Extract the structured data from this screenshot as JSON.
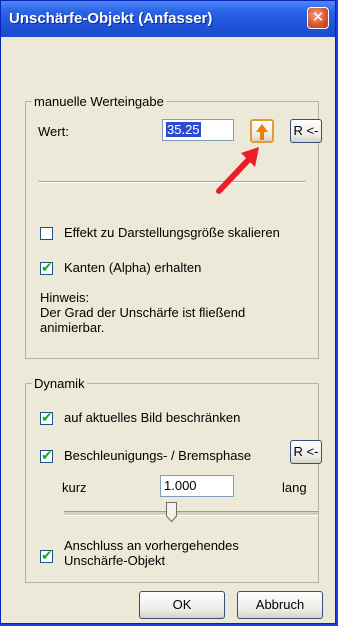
{
  "window": {
    "title": "Unschärfe-Objekt (Anfasser)"
  },
  "manual_group": {
    "legend": "manuelle Werteingabe",
    "value_label": "Wert:",
    "value": "35.25",
    "reset_label": "R <-",
    "checkbox_scale": {
      "label": "Effekt zu Darstellungsgröße skalieren",
      "checked": false
    },
    "checkbox_alpha": {
      "label": "Kanten (Alpha) erhalten",
      "checked": true
    },
    "hint_lines": [
      "Hinweis:",
      "Der Grad der Unschärfe ist fließend",
      "animierbar."
    ]
  },
  "dynamics_group": {
    "legend": "Dynamik",
    "checkbox_limit": {
      "label": "auf aktuelles Bild beschränken",
      "checked": true
    },
    "checkbox_accel": {
      "label": "Beschleunigungs- / Bremsphase",
      "checked": true
    },
    "reset_label": "R <-",
    "short_label": "kurz",
    "long_label": "lang",
    "factor": "1.000",
    "slider_position": 0.5,
    "checkbox_connect": {
      "label_line1": "Anschluss an vorhergehendes",
      "label_line2": "Unschärfe-Objekt",
      "checked": true
    }
  },
  "buttons": {
    "ok": "OK",
    "cancel": "Abbruch"
  },
  "icons": {
    "close": "close-icon",
    "arrow": "up-arrow-icon",
    "check": "checkmark-icon"
  }
}
